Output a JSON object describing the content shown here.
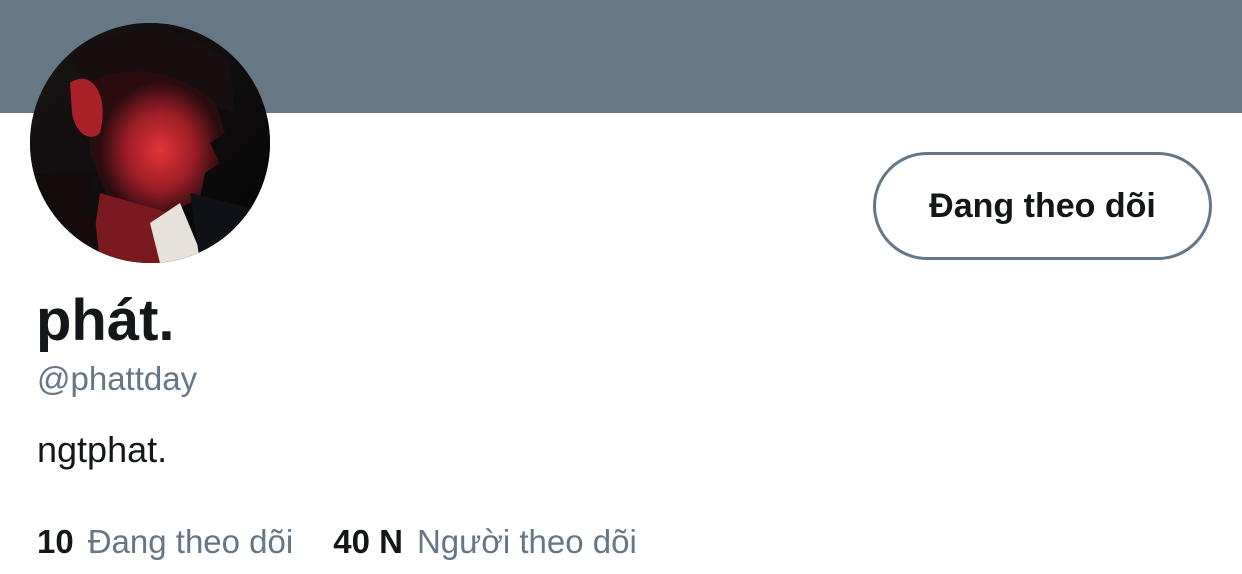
{
  "profile": {
    "display_name": "phát.",
    "handle": "@phattday",
    "bio": "ngtphat.",
    "follow_button_label": "Đang theo dõi",
    "stats": {
      "following_count": "10",
      "following_label": "Đang theo dõi",
      "followers_count": "40 N",
      "followers_label": "Người theo dõi"
    }
  },
  "colors": {
    "banner": "#667786",
    "text_primary": "#14171a",
    "text_secondary": "#657786",
    "button_border": "#657786"
  }
}
